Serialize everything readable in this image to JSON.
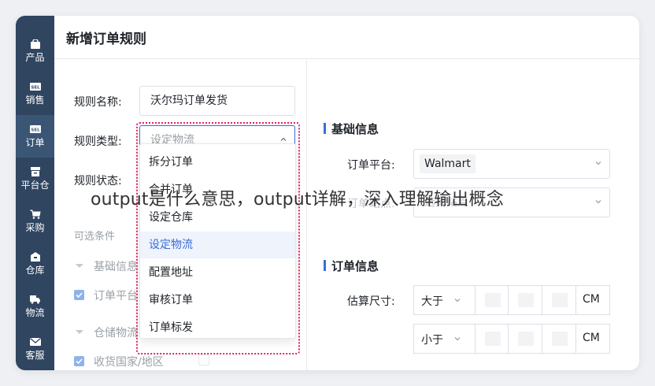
{
  "sidebar": {
    "items": [
      {
        "label": "产品",
        "icon": "bag-icon"
      },
      {
        "label": "销售",
        "icon": "sell-tag-icon"
      },
      {
        "label": "订单",
        "icon": "sell-tag-icon"
      },
      {
        "label": "平台仓",
        "icon": "warehouse-box-icon"
      },
      {
        "label": "采购",
        "icon": "cart-icon"
      },
      {
        "label": "仓库",
        "icon": "storehouse-icon"
      },
      {
        "label": "物流",
        "icon": "truck-icon"
      },
      {
        "label": "客服",
        "icon": "mail-icon"
      }
    ],
    "icon_glyphs": {
      "sell": "SEL"
    }
  },
  "header": {
    "title": "新增订单规则"
  },
  "form": {
    "name_label": "规则名称:",
    "name_value": "沃尔玛订单发货",
    "type_label": "规则类型:",
    "type_placeholder": "设定物流",
    "status_label": "规则状态:",
    "optional_label": "可选条件",
    "basic_info": "基础信息",
    "order_platform": "订单平台",
    "warehouse_logistics": "仓储物流",
    "ship_country": "收货国家/地区"
  },
  "dropdown": {
    "options": [
      "拆分订单",
      "合并订单",
      "设定仓库",
      "设定物流",
      "配置地址",
      "审核订单",
      "订单标发"
    ],
    "selected_index": 3
  },
  "right_panel": {
    "basic_section": "基础信息",
    "platform_label": "订单平台:",
    "platform_value": "Walmart",
    "site_label": "订单站点:",
    "site_placeholder": "选择站点",
    "order_section": "订单信息",
    "size_label": "估算尺寸:",
    "size_rows": [
      {
        "op": "大于",
        "unit": "CM"
      },
      {
        "op": "小于",
        "unit": "CM"
      }
    ]
  },
  "overlay_text": "output是什么意思，output详解，深入理解输出概念",
  "colors": {
    "sidebar": "#2f4560",
    "accent": "#3a6cd8",
    "dotted_highlight": "#e0245e"
  }
}
